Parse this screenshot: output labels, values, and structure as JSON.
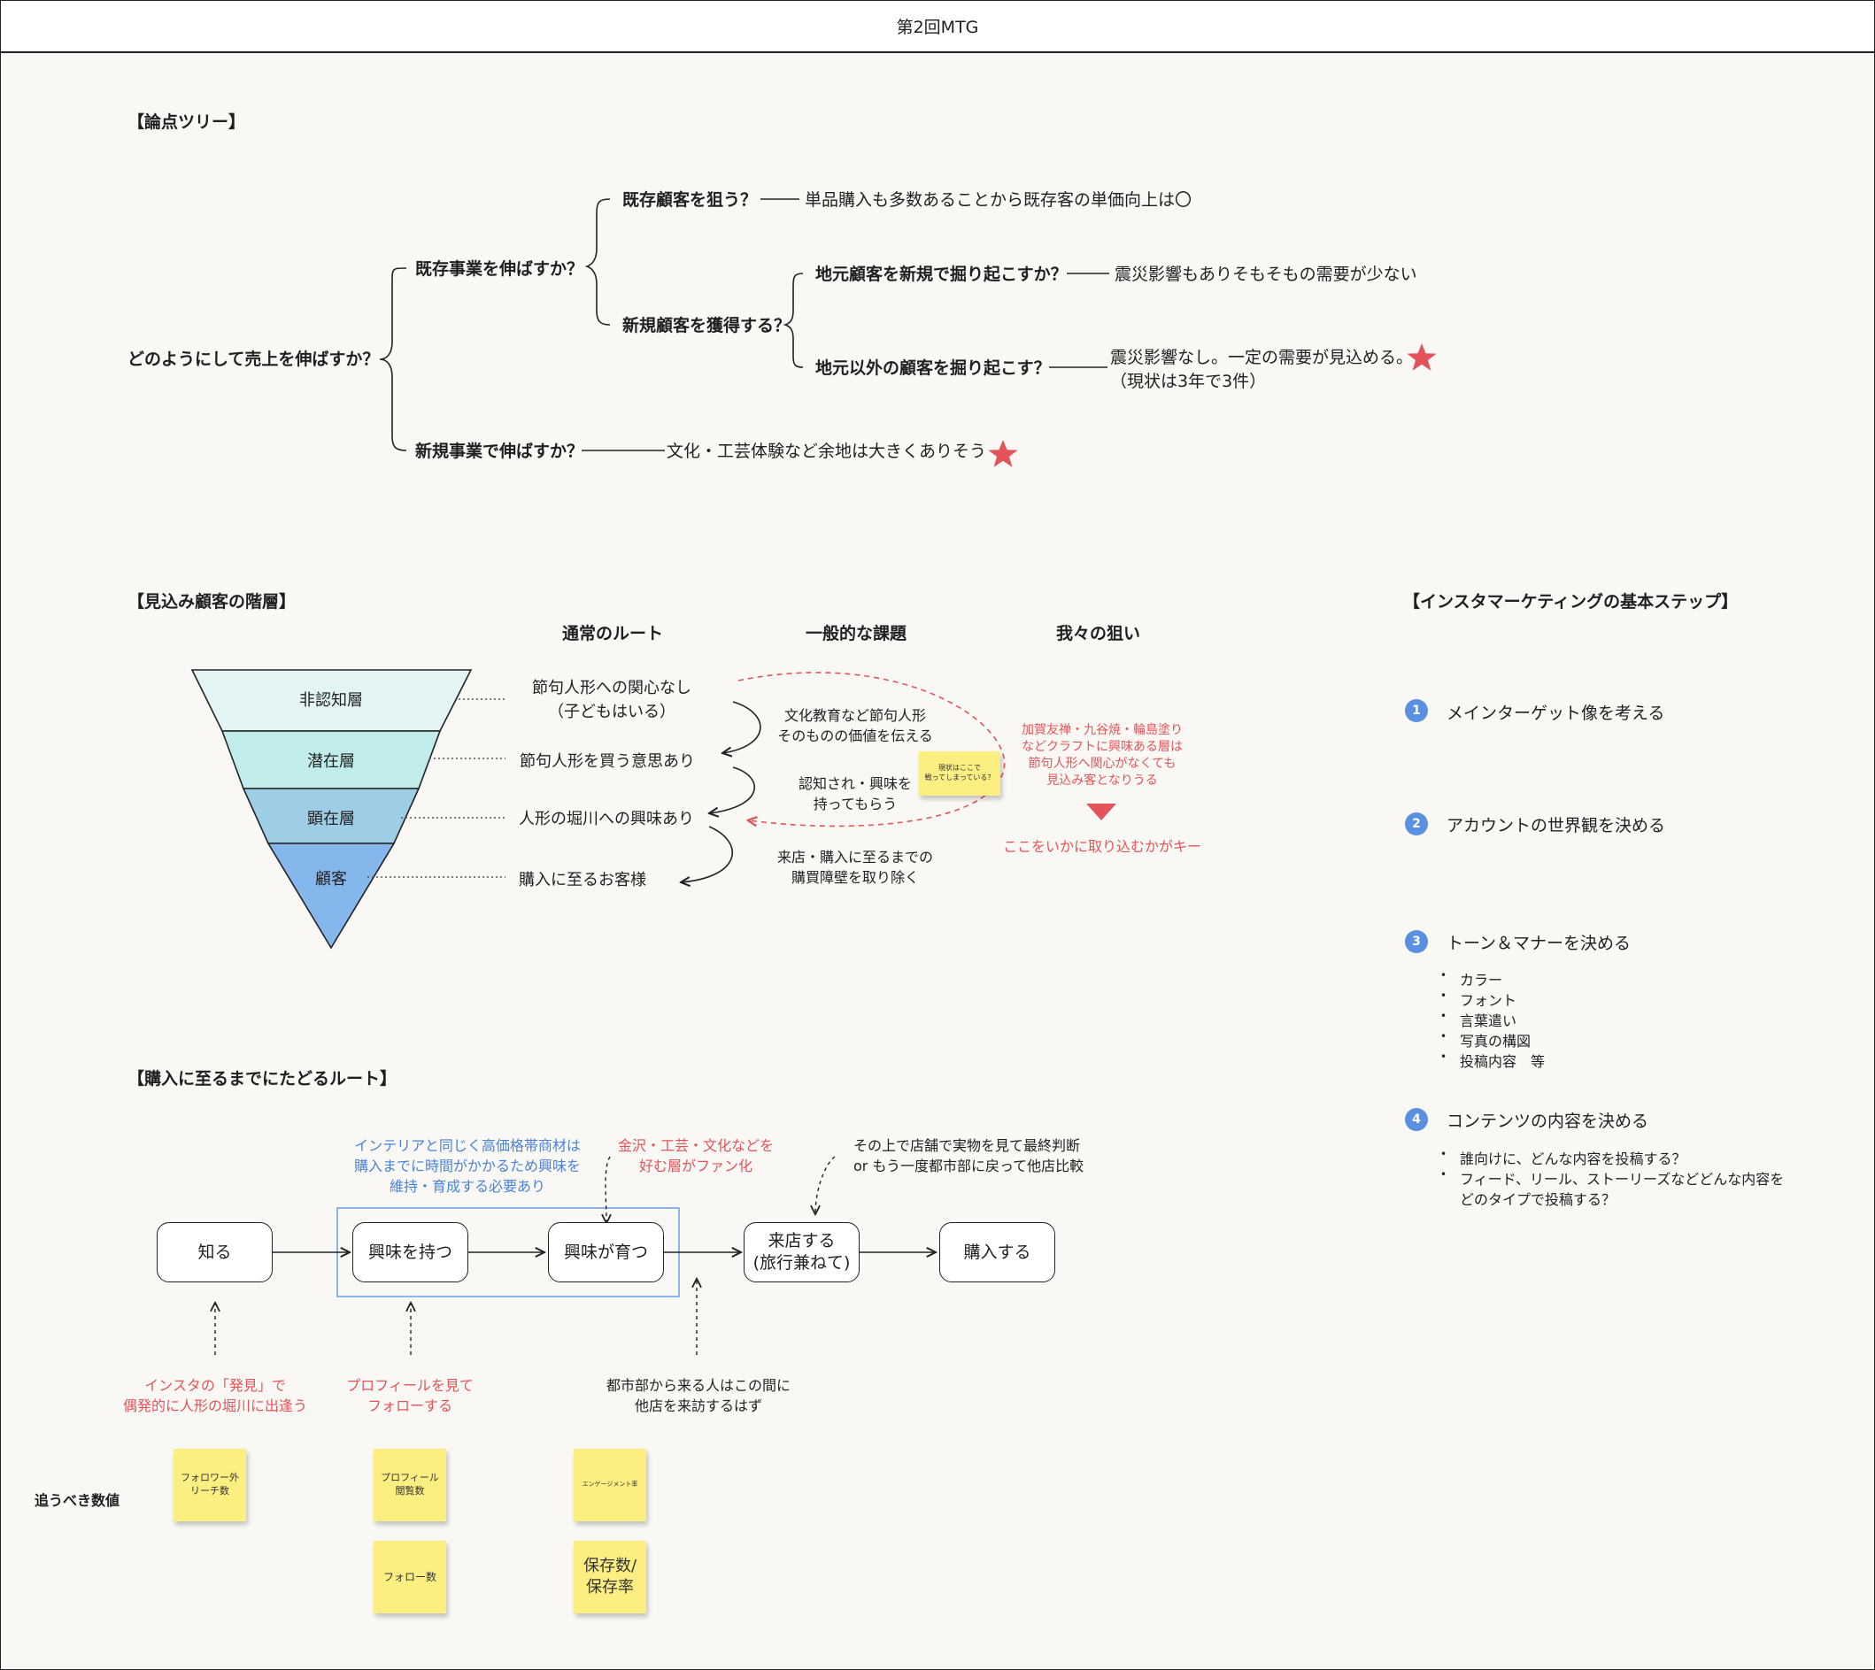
{
  "title": "第2回MTG",
  "tree": {
    "heading": "【論点ツリー】",
    "root": "どのようにして売上を伸ばすか？",
    "n1": "既存事業を伸ばすか？",
    "n2": "新規事業で伸ばすか？",
    "n11": "既存顧客を狙う？",
    "n12": "新規顧客を獲得する？",
    "n121": "地元顧客を新規で掘り起こすか？",
    "n122": "地元以外の顧客を掘り起こす？",
    "c11": "単品購入も多数あることから既存客の単価向上は〇",
    "c121": "震災影響もありそもそもの需要が少ない",
    "c122a": "震災影響なし。一定の需要が見込める。",
    "c122b": "（現状は3年で3件）",
    "c2": "文化・工芸体験など余地は大きくありそう"
  },
  "funnel": {
    "heading": "【見込み顧客の階層】",
    "col_route": "通常のルート",
    "col_issue": "一般的な課題",
    "col_aim": "我々の狙い",
    "layers": [
      "非認知層",
      "潜在層",
      "顕在層",
      "顧客"
    ],
    "layer_colors": [
      "#e3f4f4",
      "#c0ecec",
      "#9ecde6",
      "#85b6ec"
    ],
    "routes": {
      "r1a": "節句人形への関心なし",
      "r1b": "（子どもはいる）",
      "r2": "節句人形を買う意思あり",
      "r3": "人形の堀川への興味あり",
      "r4": "購入に至るお客様"
    },
    "issues": {
      "i1a": "文化教育など節句人形",
      "i1b": "そのものの価値を伝える",
      "i2a": "認知され・興味を",
      "i2b": "持ってもらう",
      "i3a": "来店・購入に至るまでの",
      "i3b": "購買障壁を取り除く"
    },
    "sticky_a": "現状はここで",
    "sticky_b": "戦ってしまっている？",
    "aim_a": "加賀友禅・九谷焼・輪島塗り",
    "aim_b": "などクラフトに興味ある層は",
    "aim_c": "節句人形へ関心がなくても",
    "aim_d": "見込み客となりうる",
    "key": "ここをいかに取り込むかがキー"
  },
  "insta": {
    "heading": "【インスタマーケティングの基本ステップ】",
    "steps": [
      {
        "num": "1",
        "label": "メインターゲット像を考える"
      },
      {
        "num": "2",
        "label": "アカウントの世界観を決める"
      },
      {
        "num": "3",
        "label": "トーン＆マナーを決める"
      },
      {
        "num": "4",
        "label": "コンテンツの内容を決める"
      }
    ],
    "step3_items": [
      "カラー",
      "フォント",
      "言葉遣い",
      "写真の構図",
      "投稿内容　等"
    ],
    "step4_items": [
      "誰向けに、どんな内容を投稿する？",
      "フィード、リール、ストーリーズなどどんな内容を",
      "どのタイプで投稿する？"
    ]
  },
  "route": {
    "heading": "【購入に至るまでにたどるルート】",
    "boxes": [
      "知る",
      "興味を持つ",
      "興味が育つ",
      "来店する",
      "(旅行兼ねて)",
      "購入する"
    ],
    "note_blue": [
      "インテリアと同じく高価格帯商材は",
      "購入までに時間がかかるため興味を",
      "維持・育成する必要あり"
    ],
    "note_red_top": [
      "金沢・工芸・文化などを",
      "好む層がファン化"
    ],
    "note_top_right": [
      "その上で店舗で実物を見て最終判断",
      "or もう一度都市部に戻って他店比較"
    ],
    "note_b1": [
      "インスタの「発見」で",
      "偶発的に人形の堀川に出逢う"
    ],
    "note_b2": [
      "プロフィールを見て",
      "フォローする"
    ],
    "note_b3": [
      "都市部から来る人はこの間に",
      "他店を来訪するはず"
    ],
    "metrics_label": "追うべき数値",
    "stickies": {
      "s1a": "フォロワー外",
      "s1b": "リーチ数",
      "s2a": "プロフィール",
      "s2b": "閲覧数",
      "s3": "エンゲージメント率",
      "s4": "フォロー数",
      "s5a": "保存数/",
      "s5b": "保存率"
    }
  },
  "colors": {
    "accent_red": "#e5535a",
    "accent_blue": "#4a82d9",
    "sticky": "#fbef82",
    "step_badge": "#5b8fe0"
  }
}
